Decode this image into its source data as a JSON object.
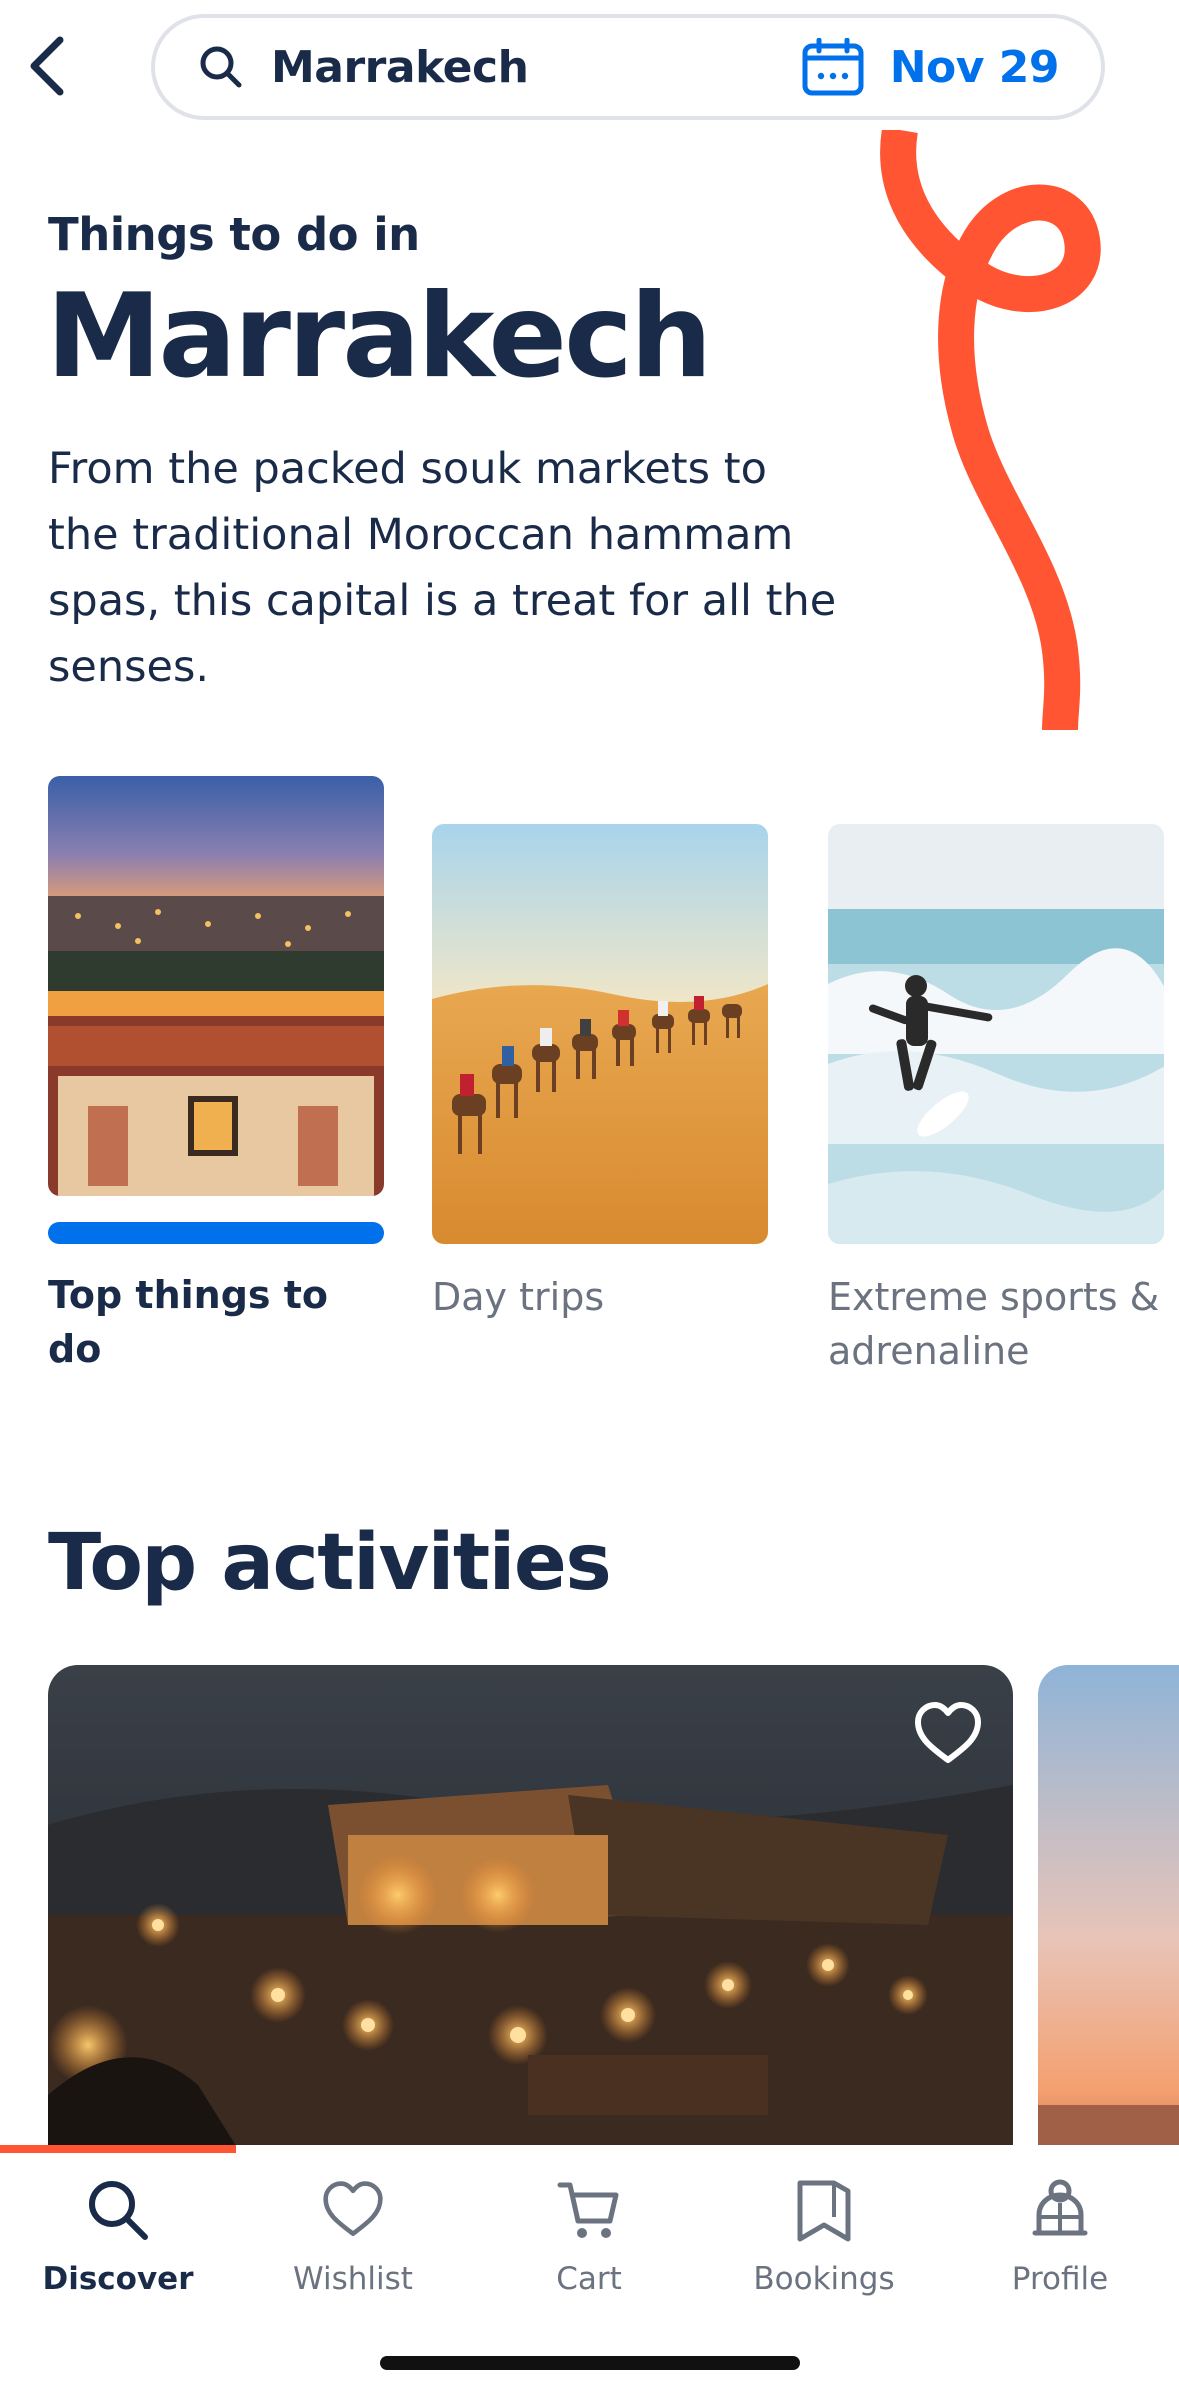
{
  "search": {
    "query": "Marrakech",
    "date": "Nov 29"
  },
  "hero": {
    "eyebrow": "Things to do in",
    "title": "Marrakech",
    "description": "From the packed souk markets to the traditional Moroccan hammam spas, this capital is a treat for all the senses."
  },
  "categories": [
    {
      "label": "Top things to do",
      "selected": true
    },
    {
      "label": "Day trips",
      "selected": false
    },
    {
      "label": "Extreme sports & adrenaline",
      "selected": false
    }
  ],
  "top_activities": {
    "title": "Top activities"
  },
  "nav": {
    "items": [
      {
        "label": "Discover",
        "icon": "search-icon",
        "active": true
      },
      {
        "label": "Wishlist",
        "icon": "heart-icon",
        "active": false
      },
      {
        "label": "Cart",
        "icon": "cart-icon",
        "active": false
      },
      {
        "label": "Bookings",
        "icon": "bookmark-icon",
        "active": false
      },
      {
        "label": "Profile",
        "icon": "profile-icon",
        "active": false
      }
    ]
  },
  "colors": {
    "brand_navy": "#1a2b49",
    "accent_blue": "#0071eb",
    "accent_orange": "#ff5533"
  }
}
